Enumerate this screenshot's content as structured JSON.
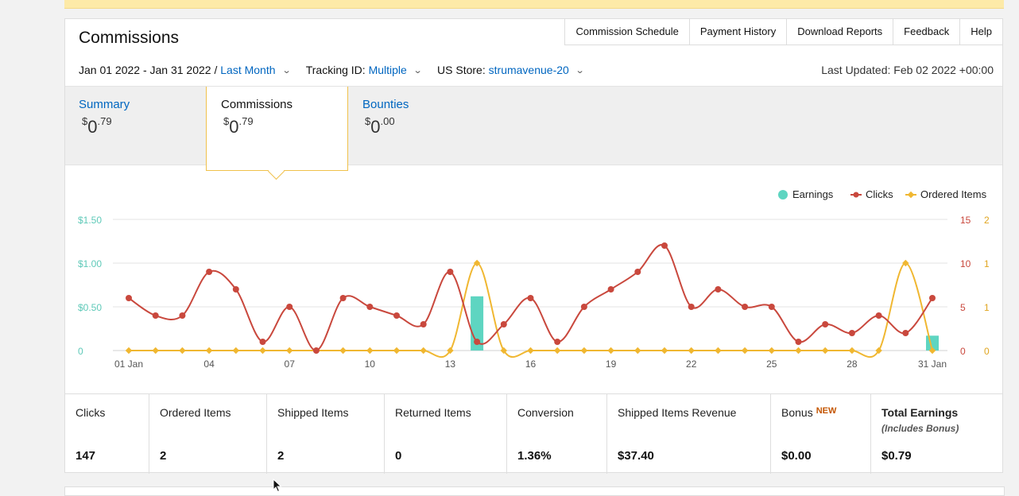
{
  "header": {
    "title": "Commissions",
    "nav": [
      "Commission Schedule",
      "Payment History",
      "Download Reports",
      "Feedback",
      "Help"
    ],
    "date_range": "Jan 01 2022 - Jan 31 2022 /",
    "date_preset": "Last Month",
    "tracking_label": "Tracking ID:",
    "tracking_value": "Multiple",
    "store_label": "US Store:",
    "store_value": "strumavenue-20",
    "last_updated": "Last Updated: Feb 02 2022 +00:00"
  },
  "tabs": [
    {
      "label": "Summary",
      "dollar": "$",
      "whole": "0",
      "cents": ".79"
    },
    {
      "label": "Commissions",
      "dollar": "$",
      "whole": "0",
      "cents": ".79"
    },
    {
      "label": "Bounties",
      "dollar": "$",
      "whole": "0",
      "cents": ".00"
    }
  ],
  "colors": {
    "earnings": "#5ed5c1",
    "clicks": "#c9483d",
    "ordered": "#f0b731",
    "link": "#0066c0"
  },
  "chart_data": {
    "type": "line",
    "legend": [
      "Earnings",
      "Clicks",
      "Ordered Items"
    ],
    "legend_placement": "top-right",
    "x": [
      "01",
      "02",
      "03",
      "04",
      "05",
      "06",
      "07",
      "08",
      "09",
      "10",
      "11",
      "12",
      "13",
      "14",
      "15",
      "16",
      "17",
      "18",
      "19",
      "20",
      "21",
      "22",
      "23",
      "24",
      "25",
      "26",
      "27",
      "28",
      "29",
      "30",
      "31"
    ],
    "x_tick_labels": [
      "01 Jan",
      "04",
      "07",
      "10",
      "13",
      "16",
      "19",
      "22",
      "25",
      "28",
      "31 Jan"
    ],
    "y_left_ticks": [
      "$1.50",
      "$1.00",
      "$0.50",
      "0"
    ],
    "y_clicks_ticks": [
      "15",
      "10",
      "5",
      "0"
    ],
    "y_ordered_ticks": [
      "2",
      "1",
      "1",
      "0"
    ],
    "series": [
      {
        "name": "Earnings",
        "kind": "bar",
        "values": [
          0,
          0,
          0,
          0,
          0,
          0,
          0,
          0,
          0,
          0,
          0,
          0,
          0,
          0.62,
          0,
          0,
          0,
          0,
          0,
          0,
          0,
          0,
          0,
          0,
          0,
          0,
          0,
          0,
          0,
          0,
          0.17
        ]
      },
      {
        "name": "Clicks",
        "kind": "line",
        "values": [
          6,
          4,
          4,
          9,
          7,
          1,
          5,
          0,
          6,
          5,
          4,
          3,
          9,
          1,
          3,
          6,
          1,
          5,
          7,
          9,
          12,
          5,
          7,
          5,
          5,
          1,
          3,
          2,
          4,
          2,
          6
        ]
      },
      {
        "name": "Ordered Items",
        "kind": "line",
        "values": [
          0,
          0,
          0,
          0,
          0,
          0,
          0,
          0,
          0,
          0,
          0,
          0,
          0,
          1,
          0,
          0,
          0,
          0,
          0,
          0,
          0,
          0,
          0,
          0,
          0,
          0,
          0,
          0,
          0,
          1,
          0
        ]
      }
    ],
    "y_earnings_range": [
      0,
      1.5
    ],
    "y_clicks_range": [
      0,
      15
    ],
    "y_ordered_range": [
      0,
      2
    ],
    "grid": true
  },
  "stats": [
    {
      "label": "Clicks",
      "value": "147"
    },
    {
      "label": "Ordered Items",
      "value": "2"
    },
    {
      "label": "Shipped Items",
      "value": "2"
    },
    {
      "label": "Returned Items",
      "value": "0"
    },
    {
      "label": "Conversion",
      "value": "1.36%"
    },
    {
      "label": "Shipped Items Revenue",
      "value": "$37.40"
    },
    {
      "label": "Bonus",
      "badge": "NEW",
      "value": "$0.00"
    },
    {
      "label": "Total Earnings",
      "sub": "(Includes Bonus)",
      "value": "$0.79"
    }
  ]
}
